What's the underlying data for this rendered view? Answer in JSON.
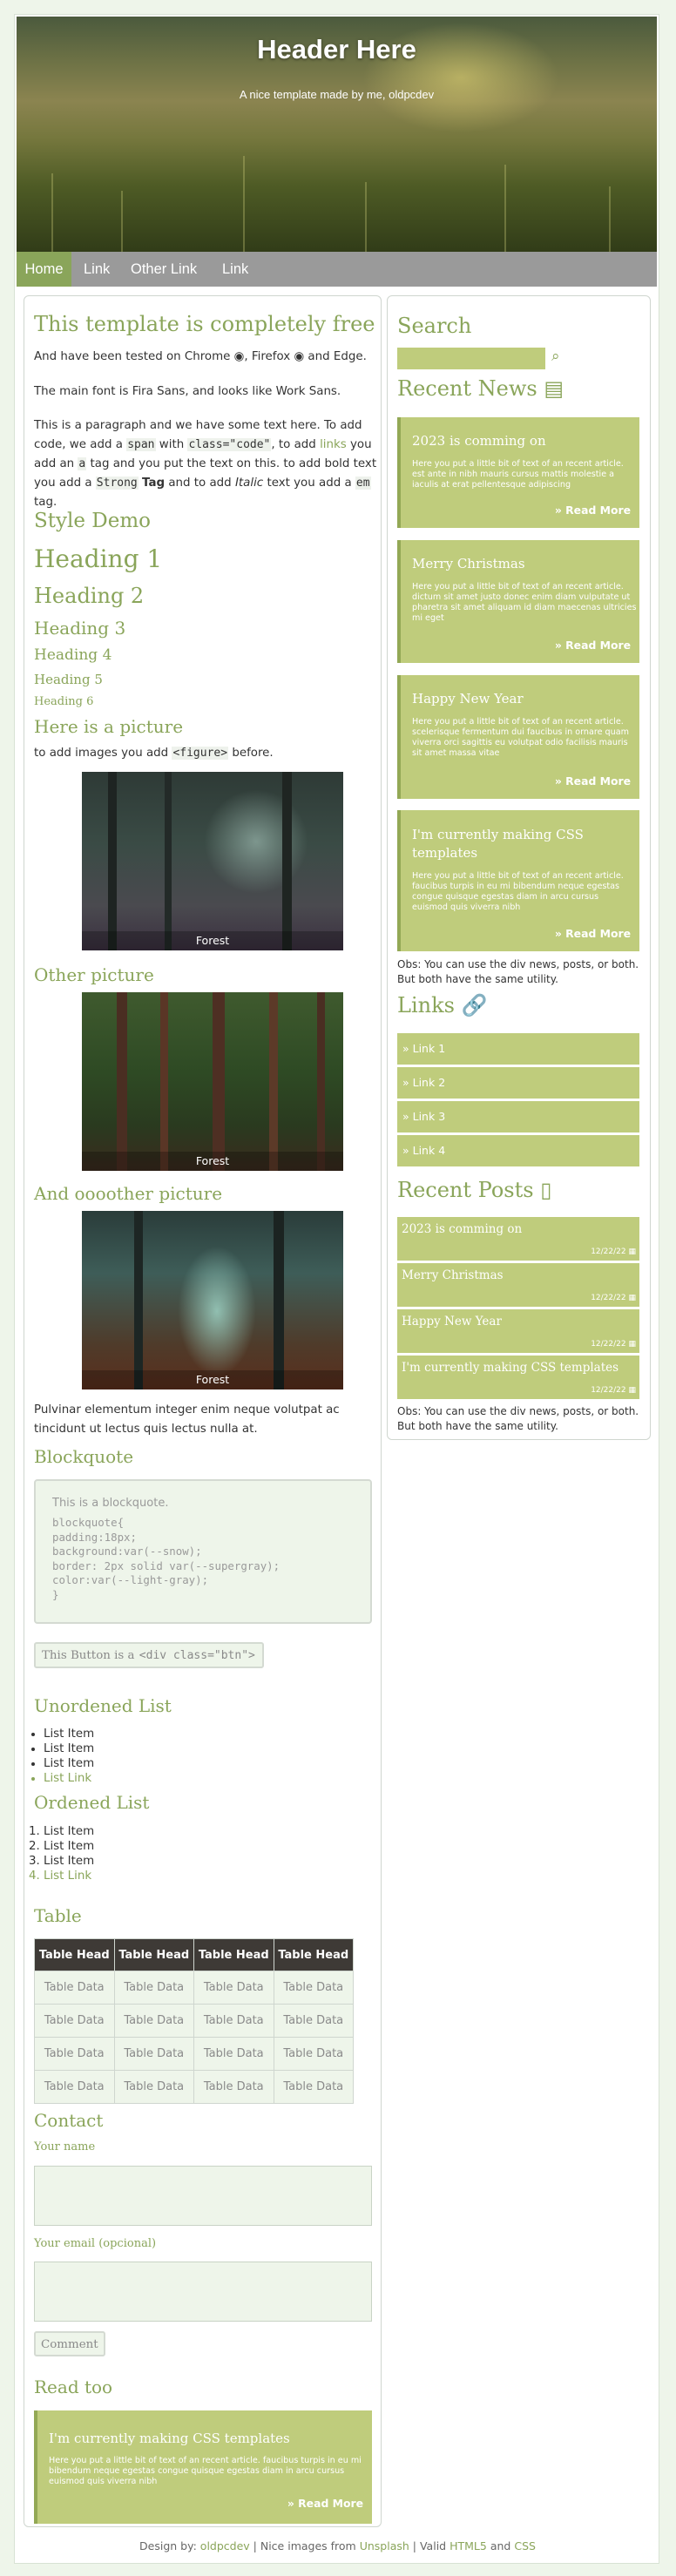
{
  "header": {
    "title": "Header Here",
    "subtitle": "A nice template made by me, oldpcdev"
  },
  "nav": {
    "items": [
      "Home",
      "Link",
      "Other Link",
      "Link"
    ]
  },
  "main": {
    "title": "This template is completely free",
    "p1_a": "And have been tested on Chrome",
    "p1_b": ", Firefox",
    "p1_c": "and Edge.",
    "p2": "The main font is Fira Sans, and looks like Work Sans.",
    "p3": {
      "s1": "This is a paragraph and we have some text here. To add code, we add a",
      "code1": "span",
      "s2": "with",
      "code2": "class=\"code\"",
      "s3": ", to add",
      "link": "links",
      "s4": "you add an",
      "code3": "a",
      "s5": "tag and you put the text on this. to add bold text you add a",
      "strong": "Strong",
      "tag": "Tag",
      "s6": "and to add",
      "italic": "Italic",
      "s7": "text you add a",
      "code4": "em",
      "s8": "tag."
    },
    "style_demo": "Style Demo",
    "h1": "Heading 1",
    "h2": "Heading 2",
    "h3": "Heading 3",
    "h4": "Heading 4",
    "h5": "Heading 5",
    "h6": "Heading 6",
    "picture_heading": "Here is a picture",
    "picture_text_a": "to add images you add",
    "picture_code": "<figure>",
    "picture_text_b": "before.",
    "fig1_caption": "Forest",
    "other_picture": "Other picture",
    "fig2_caption": "Forest",
    "another_picture": "And oooother picture",
    "fig3_caption": "Forest",
    "pulvinar": "Pulvinar elementum integer enim neque volutpat ac tincidunt ut lectus quis lectus nulla at.",
    "blockquote_heading": "Blockquote",
    "blockquote_text": "This is a blockquote.",
    "blockquote_code": [
      "blockquote{",
      "padding:18px;",
      "background:var(--snow);",
      "border: 2px solid var(--supergray);",
      "color:var(--light-gray);",
      "}"
    ],
    "button_a": "This Button is a",
    "button_code": "<div class=\"btn\">",
    "ul_heading": "Unordened List",
    "ul_items": [
      "List Item",
      "List Item",
      "List Item",
      "List Link"
    ],
    "ol_heading": "Ordened List",
    "ol_items": [
      "List Item",
      "List Item",
      "List Item",
      "List Link"
    ],
    "table_heading": "Table",
    "table_headers": [
      "Table Head",
      "Table Head",
      "Table Head",
      "Table Head"
    ],
    "table_cell": "Table Data",
    "contact_heading": "Contact",
    "name_label": "Your name",
    "email_label": "Your email (opcional)",
    "comment_button": "Comment",
    "read_too": "Read too",
    "read_card": {
      "title": "I'm currently making CSS templates",
      "body": "Here you put a little bit of text of an recent article. faucibus turpis in eu mi bibendum neque egestas congue quisque egestas diam in arcu cursus euismod quis viverra nibh",
      "more": "» Read More"
    }
  },
  "sidebar": {
    "search_heading": "Search",
    "recent_news": "Recent News",
    "news": [
      {
        "title": "2023 is comming on",
        "body": "Here you put a little bit of text of an recent article. est ante in nibh mauris cursus mattis molestie a iaculis at erat pellentesque adipiscing",
        "more": "» Read More"
      },
      {
        "title": "Merry Christmas",
        "body": "Here you put a little bit of text of an recent article. dictum sit amet justo donec enim diam vulputate ut pharetra sit amet aliquam id diam maecenas ultricies mi eget",
        "more": "» Read More"
      },
      {
        "title": "Happy New Year",
        "body": "Here you put a little bit of text of an recent article. scelerisque fermentum dui faucibus in ornare quam viverra orci sagittis eu volutpat odio facilisis mauris sit amet massa vitae",
        "more": "» Read More"
      },
      {
        "title": "I'm currently making CSS templates",
        "body": "Here you put a little bit of text of an recent article. faucibus turpis in eu mi bibendum neque egestas congue quisque egestas diam in arcu cursus euismod quis viverra nibh",
        "more": "» Read More"
      }
    ],
    "obs1": "Obs: You can use the div news, posts, or both. But both have the same utility.",
    "links_heading": "Links",
    "links": [
      "» Link 1",
      "» Link 2",
      "» Link 3",
      "» Link 4"
    ],
    "recent_posts": "Recent Posts",
    "posts": [
      {
        "title": "2023 is comming on",
        "date": "12/22/22"
      },
      {
        "title": "Merry Christmas",
        "date": "12/22/22"
      },
      {
        "title": "Happy New Year",
        "date": "12/22/22"
      },
      {
        "title": "I'm currently making CSS templates",
        "date": "12/22/22"
      }
    ],
    "obs2": "Obs: You can use the div news, posts, or both. But both have the same utility."
  },
  "footer": {
    "a": "Design by:",
    "author": "oldpcdev",
    "b": "| Nice images from",
    "unsplash": "Unsplash",
    "c": "| Valid",
    "html5": "HTML5",
    "d": "and",
    "css": "CSS"
  },
  "colors": {
    "accent": "#8aa55a",
    "card": "#bfcc7c",
    "nav": "#9a9a9a",
    "table_head": "#3e3a36"
  }
}
